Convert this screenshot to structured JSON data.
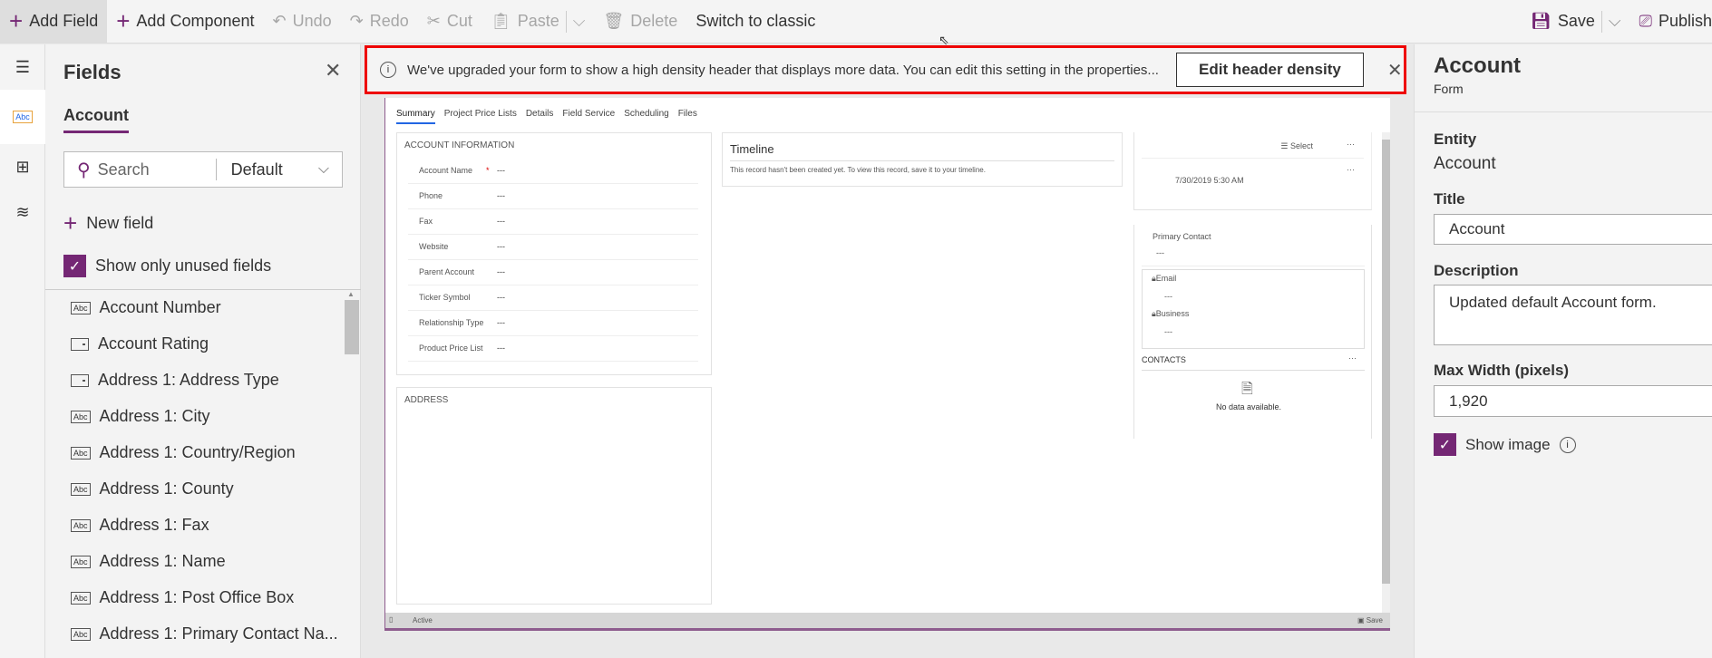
{
  "toolbar": {
    "add_field": "Add Field",
    "add_component": "Add Component",
    "undo": "Undo",
    "redo": "Redo",
    "cut": "Cut",
    "paste": "Paste",
    "delete": "Delete",
    "switch_classic": "Switch to classic",
    "save": "Save",
    "publish": "Publish"
  },
  "fields_panel": {
    "title": "Fields",
    "tab": "Account",
    "search_placeholder": "Search",
    "filter": "Default",
    "new_field": "New field",
    "show_unused": "Show only unused fields",
    "items": [
      {
        "label": "Account Number",
        "type": "text"
      },
      {
        "label": "Account Rating",
        "type": "option"
      },
      {
        "label": "Address 1: Address Type",
        "type": "option"
      },
      {
        "label": "Address 1: City",
        "type": "text"
      },
      {
        "label": "Address 1: Country/Region",
        "type": "text"
      },
      {
        "label": "Address 1: County",
        "type": "text"
      },
      {
        "label": "Address 1: Fax",
        "type": "text"
      },
      {
        "label": "Address 1: Name",
        "type": "text"
      },
      {
        "label": "Address 1: Post Office Box",
        "type": "text"
      },
      {
        "label": "Address 1: Primary Contact Na...",
        "type": "text"
      }
    ]
  },
  "banner": {
    "message": "We've upgraded your form to show a high density header that displays more data. You can edit this setting in the properties...",
    "button": "Edit header density"
  },
  "form": {
    "tabs": [
      "Summary",
      "Project Price Lists",
      "Details",
      "Field Service",
      "Scheduling",
      "Files"
    ],
    "account_info": {
      "title": "ACCOUNT INFORMATION",
      "rows": [
        {
          "label": "Account Name",
          "value": "---",
          "required": "*"
        },
        {
          "label": "Phone",
          "value": "---"
        },
        {
          "label": "Fax",
          "value": "---"
        },
        {
          "label": "Website",
          "value": "---"
        },
        {
          "label": "Parent Account",
          "value": "---"
        },
        {
          "label": "Ticker Symbol",
          "value": "---"
        },
        {
          "label": "Relationship Type",
          "value": "---"
        },
        {
          "label": "Product Price List",
          "value": "---"
        }
      ]
    },
    "address_title": "ADDRESS",
    "timeline": {
      "title": "Timeline",
      "message": "This record hasn't been created yet.  To view this record, save it to your timeline."
    },
    "side": {
      "select": "Select",
      "more": "···",
      "date": "7/30/2019 5:30 AM",
      "primary_contact": "Primary Contact",
      "primary_value": "---",
      "email": "Email",
      "email_value": "---",
      "business": "Business",
      "business_value": "---",
      "contacts": "CONTACTS",
      "no_data": "No data available."
    },
    "status": {
      "left": "Active",
      "right": "Save"
    }
  },
  "properties": {
    "title": "Account",
    "subtitle": "Form",
    "entity_label": "Entity",
    "entity_value": "Account",
    "title_label": "Title",
    "title_value": "Account",
    "description_label": "Description",
    "description_value": "Updated default Account form.",
    "max_width_label": "Max Width (pixels)",
    "max_width_value": "1,920",
    "show_image": "Show image"
  },
  "colors": {
    "accent": "#742774",
    "banner_border": "#e00000",
    "tab_underline": "#2266e3"
  }
}
